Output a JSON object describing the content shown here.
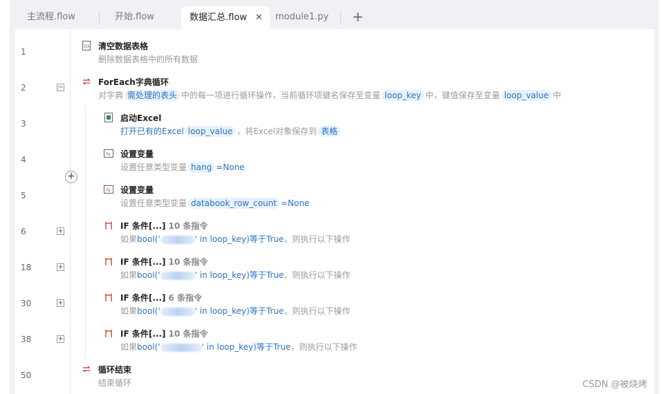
{
  "tabs": [
    {
      "label": "主流程.flow"
    },
    {
      "label": "开始.flow"
    },
    {
      "label": "数据汇总.flow"
    },
    {
      "label": "module1.py"
    }
  ],
  "tab_close": "✕",
  "tab_add": "+",
  "line_numbers": [
    "1",
    "2",
    "3",
    "4",
    "5",
    "6",
    "18",
    "30",
    "38",
    "50"
  ],
  "commands": {
    "c1": {
      "title": "清空数据表格",
      "desc": "删除数据表格中的所有数据"
    },
    "c2": {
      "title": "ForEach字典循环",
      "d1": "对字典",
      "chip1": "需处理的表头",
      "d2": "中的每一项进行循环操作，当前循环项键名保存至变量",
      "chip2": "loop_key",
      "d3": "中，键值保存至变量",
      "chip3": "loop_value",
      "d4": "中"
    },
    "c3": {
      "title": "启动Excel",
      "d1": "打开已有的Excel",
      "chip1": "loop_value",
      "d2": "，将Excel对象保存到",
      "chip2": "表格"
    },
    "c4": {
      "title": "设置变量",
      "d1": "设置任意类型变量",
      "chip1": "hang",
      "d2": "=None"
    },
    "c5": {
      "title": "设置变量",
      "d1": "设置任意类型变量",
      "chip1": "databook_row_count",
      "d2": "=None"
    },
    "c6": {
      "title": "IF 条件[...]",
      "count": "10 条指令",
      "d1": "如果",
      "expr_a": "bool('",
      "expr_b": "' in loop_key)等于True",
      "d2": "，则执行以下操作"
    },
    "c7": {
      "title": "IF 条件[...]",
      "count": "10 条指令",
      "d1": "如果",
      "expr_a": "bool('",
      "expr_b": "' in loop_key)等于True",
      "d2": "，则执行以下操作"
    },
    "c8": {
      "title": "IF 条件[...]",
      "count": "6 条指令",
      "d1": "如果",
      "expr_a": "bool('",
      "expr_b": "' in loop_key)等于True",
      "d2": "，则执行以下操作"
    },
    "c9": {
      "title": "IF 条件[...]",
      "count": "10 条指令",
      "d1": "如果",
      "expr_a": "bool('",
      "expr_b": "' in loop_key)等于True",
      "d2": "，则执行以下操作"
    },
    "c10": {
      "title": "循环结束",
      "desc": "结束循环"
    }
  },
  "watermark": "CSDN @被烧烤",
  "colors": {
    "accent": "#2a73c6",
    "chip_bg": "#e8f1fc"
  }
}
